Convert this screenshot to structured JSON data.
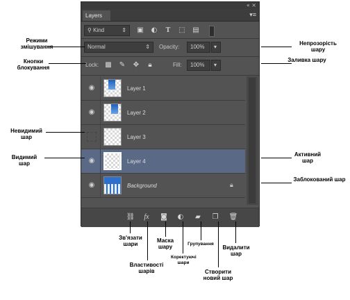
{
  "panel": {
    "title_controls": "« ×",
    "tab_label": "Layers",
    "menu_icon": "panel-menu-icon",
    "filter": {
      "kind_label": "Kind",
      "search_icon": "search-icon"
    },
    "blend_mode": "Normal",
    "opacity_label": "Opacity:",
    "opacity_value": "100%",
    "lock_label": "Lock:",
    "fill_label": "Fill:",
    "fill_value": "100%",
    "layers": [
      {
        "name": "Layer 1",
        "visible": true,
        "active": false,
        "locked": false
      },
      {
        "name": "Layer 2",
        "visible": true,
        "active": false,
        "locked": false
      },
      {
        "name": "Layer 3",
        "visible": false,
        "active": false,
        "locked": false
      },
      {
        "name": "Layer 4",
        "visible": true,
        "active": true,
        "locked": false
      },
      {
        "name": "Background",
        "visible": true,
        "active": false,
        "locked": true
      }
    ],
    "bottom_icons": [
      "link-icon",
      "fx-icon",
      "mask-icon",
      "adjustment-icon",
      "folder-icon",
      "new-layer-icon",
      "trash-icon"
    ]
  },
  "annotations": {
    "blend_modes": "Режими змішування",
    "lock_buttons": "Кнопки блокування",
    "hidden_layer": "Невидимий шар",
    "visible_layer": "Видимий шар",
    "opacity": "Непрозорість шару",
    "fill": "Заливка шару",
    "active_layer": "Активний шар",
    "locked_layer": "Заблокований шар",
    "link_layers": "Зв'язати шари",
    "layer_styles": "Властивості шарів",
    "layer_mask": "Маска шару",
    "adjustment_layers": "Коректуючі шари",
    "grouping": "Групування",
    "new_layer": "Створити новий шар",
    "delete_layer": "Видалити шар"
  }
}
